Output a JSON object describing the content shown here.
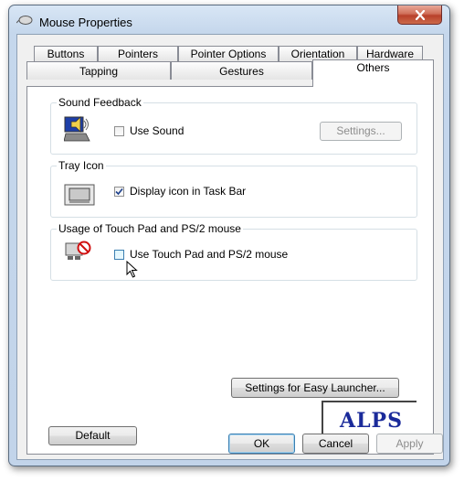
{
  "window": {
    "title": "Mouse Properties"
  },
  "tabs": {
    "row1": [
      "Buttons",
      "Pointers",
      "Pointer Options",
      "Orientation",
      "Hardware"
    ],
    "row2": [
      "Tapping",
      "Gestures",
      "Others"
    ],
    "active": "Others"
  },
  "sound_feedback": {
    "title": "Sound Feedback",
    "checkbox_label": "Use Sound",
    "checked": false,
    "settings_button": "Settings...",
    "settings_enabled": false,
    "icon": "speaker-laptop-icon"
  },
  "tray_icon": {
    "title": "Tray Icon",
    "checkbox_label": "Display icon in Task Bar",
    "checked": true,
    "icon": "touchpad-icon"
  },
  "usage": {
    "title": "Usage of Touch Pad and PS/2 mouse",
    "checkbox_label": "Use Touch Pad and PS/2 mouse",
    "checked": false,
    "icon": "touchpad-disabled-icon"
  },
  "easy_launcher_button": "Settings for Easy Launcher...",
  "default_button": "Default",
  "logo_text": "ALPS",
  "footer": {
    "ok": "OK",
    "cancel": "Cancel",
    "apply": "Apply",
    "apply_enabled": false
  },
  "colors": {
    "accent": "#3c7fb1",
    "logo": "#1a2a9a",
    "close": "#c8533a"
  }
}
